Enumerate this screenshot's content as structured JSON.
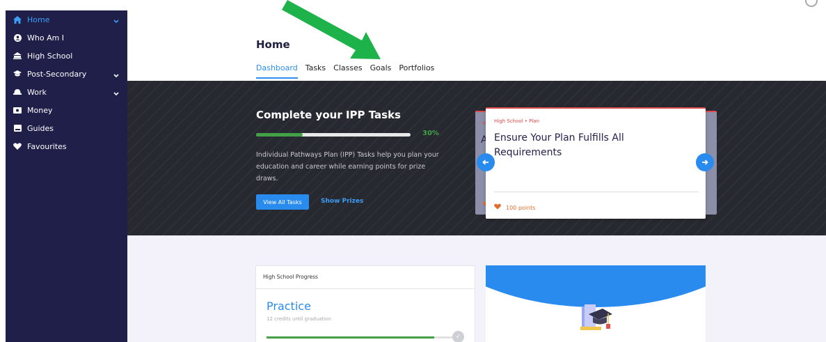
{
  "sidebar": {
    "items": [
      {
        "label": "Home",
        "icon": "home-icon",
        "active": true,
        "has_chevron": true
      },
      {
        "label": "Who Am I",
        "icon": "person-circle-icon",
        "active": false,
        "has_chevron": false
      },
      {
        "label": "High School",
        "icon": "school-icon",
        "active": false,
        "has_chevron": false
      },
      {
        "label": "Post-Secondary",
        "icon": "graduation-cap-icon",
        "active": false,
        "has_chevron": true
      },
      {
        "label": "Work",
        "icon": "helmet-icon",
        "active": false,
        "has_chevron": true
      },
      {
        "label": "Money",
        "icon": "money-icon",
        "active": false,
        "has_chevron": false
      },
      {
        "label": "Guides",
        "icon": "book-icon",
        "active": false,
        "has_chevron": false
      },
      {
        "label": "Favourites",
        "icon": "heart-icon",
        "active": false,
        "has_chevron": false
      }
    ]
  },
  "page": {
    "title": "Home",
    "tabs": [
      "Dashboard",
      "Tasks",
      "Classes",
      "Goals",
      "Portfolios"
    ],
    "active_tab": "Dashboard"
  },
  "hero": {
    "title": "Complete your IPP Tasks",
    "progress_percent": 30,
    "progress_label": "30%",
    "description": "Individual Pathways Plan (IPP) Tasks help you plan your education and career while earning points for prize draws.",
    "view_all_label": "View All Tasks",
    "show_prizes_label": "Show Prizes"
  },
  "carousel": {
    "card": {
      "breadcrumb": "High School • Plan",
      "title": "Ensure Your Plan Fulfills All Requirements",
      "points": "100 points"
    },
    "back_peek": {
      "letter_top": "W",
      "letter_big": "A",
      "heart": "♥"
    }
  },
  "progress_card": {
    "header": "High School Progress",
    "title": "Practice",
    "subtitle": "12 credits until graduation",
    "progress_fraction": 0.86
  },
  "colors": {
    "sidebar_bg": "#1f1f4a",
    "accent_blue": "#2a8bef",
    "green": "#43a047",
    "red": "#e04b4b",
    "orange": "#e26d2c",
    "arrow_green": "#1db34a"
  }
}
